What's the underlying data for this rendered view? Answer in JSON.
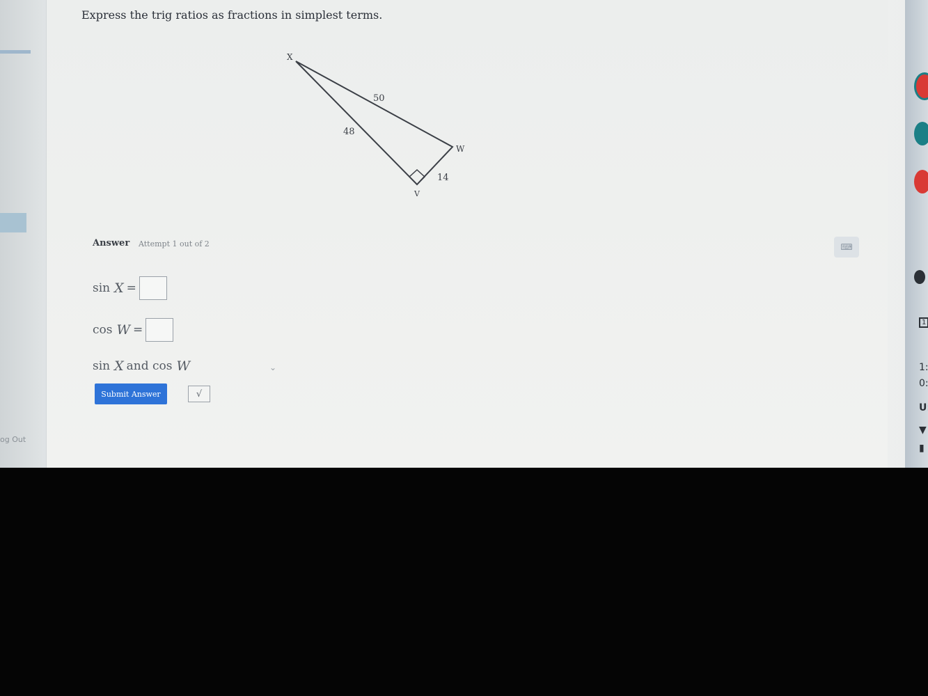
{
  "sidebar": {
    "logout_label": "og Out"
  },
  "question": {
    "prompt": "Express the trig ratios as fractions in simplest terms."
  },
  "diagram": {
    "vertex_x": "X",
    "vertex_w": "W",
    "vertex_v": "V",
    "side_xw": "50",
    "side_xv": "48",
    "side_vw": "14"
  },
  "answer": {
    "label": "Answer",
    "attempt": "Attempt 1 out of 2",
    "sinx_func": "sin",
    "sinx_var": "X",
    "cosw_func": "cos",
    "cosw_var": "W",
    "eq_sign": "=",
    "dropdown_sin": "sin",
    "dropdown_x": "X",
    "dropdown_and": "and cos",
    "dropdown_w": "W",
    "submit_label": "Submit Answer",
    "sqrt_symbol": "√"
  },
  "shelf": {
    "clock_line1": "1:",
    "clock_line2": "0:",
    "region": "U:",
    "badge": "1"
  },
  "colors": {
    "submit_bg": "#2e73d8",
    "chrome_red": "#d93a35",
    "chrome_teal": "#1b7f86"
  }
}
